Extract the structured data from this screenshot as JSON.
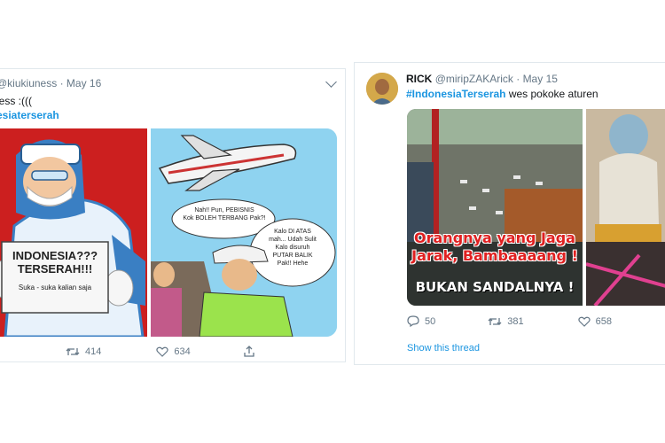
{
  "left_tweet": {
    "handle": "@kiukiuness",
    "separator": "·",
    "date": "May 16",
    "text_line1": "less :(((",
    "hashtag": "esiaterserah",
    "poster": {
      "sign_line1": "INDONESIA???",
      "sign_line2": "TERSERAH!!!",
      "sign_line3": "Suka - suka kalian saja"
    },
    "comic": {
      "bubble1_line1": "Nah!! Pun, PEBISNIS",
      "bubble1_line2": "Kok BOLEH TERBANG Pak?!",
      "bubble2_line1": "Kalo DI ATAS",
      "bubble2_line2": "mah... Udah Sulit",
      "bubble2_line3": "Kalo disuruh",
      "bubble2_line4": "PUTAR BALIK",
      "bubble2_line5": "Pak!! Hehe"
    },
    "retweets": "414",
    "likes": "634"
  },
  "right_tweet": {
    "name": "RICK",
    "handle": "@miripZAKArick",
    "separator": "·",
    "date": "May 15",
    "hashtag": "#IndonesiaTerserah",
    "text_rest": " wes pokoke aturen",
    "meme": {
      "line1": "Orangnya yang Jaga",
      "line2": "Jarak, Bambaaaang !",
      "line3": "BUKAN SANDALNYA !"
    },
    "replies": "50",
    "retweets": "381",
    "likes": "658",
    "show_thread": "Show this thread"
  },
  "colors": {
    "link_blue": "#1b95e0",
    "muted_gray": "#657786",
    "border": "#e1e8ed",
    "poster_red": "#cc1f1f",
    "comic_sky": "#8fd3f0"
  },
  "icons": [
    "chevron-down-icon",
    "retweet-icon",
    "like-icon",
    "share-icon",
    "reply-icon"
  ]
}
